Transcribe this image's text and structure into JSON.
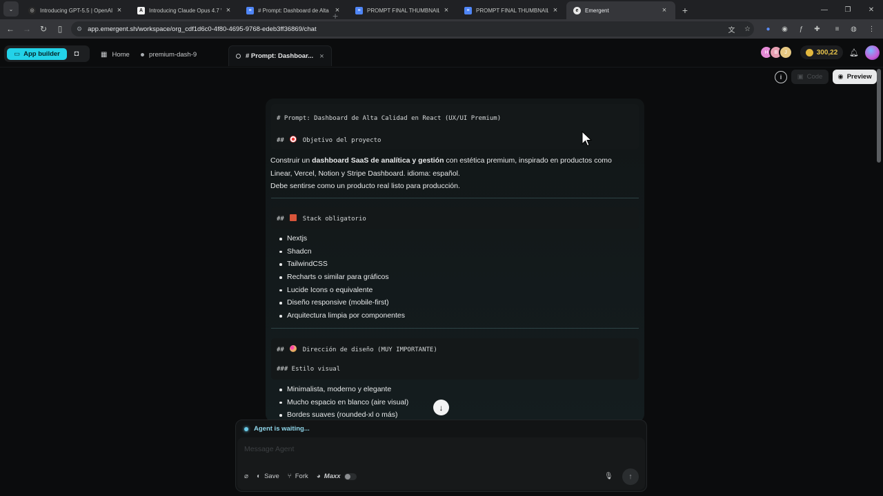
{
  "browser": {
    "tabs": [
      {
        "title": "Introducing GPT-5.5 | OpenAI",
        "favicon": "openai-icon",
        "color": "#d9d9d9"
      },
      {
        "title": "Introducing Claude Opus 4.7 \\",
        "favicon": "anthropic-icon",
        "color": "#f2f2f2"
      },
      {
        "title": "# Prompt: Dashboard de Alta C",
        "favicon": "docs-icon",
        "color": "#4f86f7"
      },
      {
        "title": "PROMPT FINAL THUMBNAILPR",
        "favicon": "docs-icon",
        "color": "#4f86f7"
      },
      {
        "title": "PROMPT FINAL THUMBNAIL PR",
        "favicon": "docs-icon",
        "color": "#4f86f7"
      },
      {
        "title": "Emergent",
        "favicon": "emergent-icon",
        "color": "#e8e8e8",
        "active": true
      }
    ],
    "url": "app.emergent.sh/workspace/org_cdf1d6c0-4f80-4695-9768-edeb3ff36869/chat"
  },
  "appbar": {
    "app_builder_label": "App builder",
    "home_label": "Home",
    "project_tab_label": "premium-dash-9",
    "current_tab_label": "# Prompt: Dashboar...",
    "credits": "300,22",
    "avatar_initials": [
      "H",
      "B",
      "J"
    ]
  },
  "view_toggle": {
    "code_label": "Code",
    "preview_label": "Preview"
  },
  "message": {
    "h1": "# Prompt: Dashboard de Alta Calidad en React (UX/UI Premium)",
    "h2_objective_prefix": "##",
    "h2_objective": "Objetivo del proyecto",
    "intro_before": "Construir un ",
    "intro_bold": "dashboard SaaS de analítica y gestión",
    "intro_after": " con estética premium, inspirado en productos como",
    "intro_line2": "Linear, Vercel, Notion y Stripe Dashboard. idioma: español.",
    "intro_line3": "Debe sentirse como un producto real listo para producción.",
    "h2_stack_prefix": "##",
    "h2_stack": "Stack obligatorio",
    "stack_items": [
      "Nextjs",
      "Shadcn",
      "TailwindCSS",
      "Recharts o similar para gráficos",
      "Lucide Icons o equivalente",
      "Diseño responsive (mobile-first)",
      "Arquitectura limpia por componentes"
    ],
    "h2_design_prefix": "##",
    "h2_design": "Dirección de diseño (MUY IMPORTANTE)",
    "h3_style": "### Estilo visual",
    "style_items": [
      "Minimalista, moderno y elegante",
      "Mucho espacio en blanco (aire visual)",
      "Bordes suaves (rounded-xl o más)"
    ]
  },
  "composer": {
    "status": "Agent is waiting...",
    "placeholder": "Message Agent",
    "save_label": "Save",
    "fork_label": "Fork",
    "maxx_label": "Maxx"
  },
  "colors": {
    "accent": "#23d2e8",
    "credit": "#e3b83e",
    "status": "#69c9e6"
  }
}
